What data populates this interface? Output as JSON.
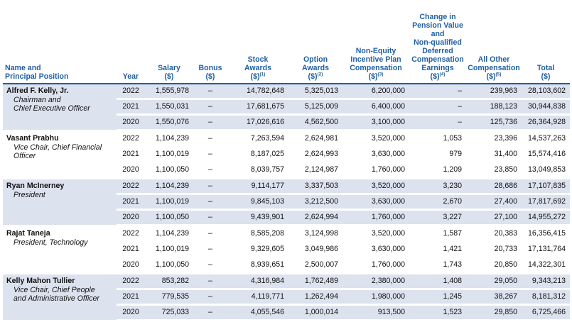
{
  "headers": {
    "name": "Name and\nPrincipal Position",
    "year": "Year",
    "salary": "Salary\n($)",
    "bonus": "Bonus\n($)",
    "stock": "Stock\nAwards\n($)",
    "stock_note": "(1)",
    "option": "Option\nAwards\n($)",
    "option_note": "(2)",
    "nonequity": "Non-Equity\nIncentive Plan\nCompensation\n($)",
    "nonequity_note": "(3)",
    "pension": "Change in\nPension Value\nand\nNon-qualified\nDeferred\nCompensation\nEarnings\n($)",
    "pension_note": "(4)",
    "other": "All Other\nCompensation\n($)",
    "other_note": "(5)",
    "total": "Total\n($)"
  },
  "executives": [
    {
      "name": "Alfred F. Kelly, Jr.",
      "title": "Chairman and\nChief Executive Officer",
      "rows": [
        {
          "year": "2022",
          "salary": "1,555,978",
          "bonus": "–",
          "stock": "14,782,648",
          "option": "5,325,013",
          "nonequity": "6,200,000",
          "pension": "–",
          "other": "239,963",
          "total": "28,103,602"
        },
        {
          "year": "2021",
          "salary": "1,550,031",
          "bonus": "–",
          "stock": "17,681,675",
          "option": "5,125,009",
          "nonequity": "6,400,000",
          "pension": "–",
          "other": "188,123",
          "total": "30,944,838"
        },
        {
          "year": "2020",
          "salary": "1,550,076",
          "bonus": "–",
          "stock": "17,026,616",
          "option": "4,562,500",
          "nonequity": "3,100,000",
          "pension": "–",
          "other": "125,736",
          "total": "26,364,928"
        }
      ]
    },
    {
      "name": "Vasant Prabhu",
      "title": "Vice Chair, Chief Financial\nOfficer",
      "rows": [
        {
          "year": "2022",
          "salary": "1,104,239",
          "bonus": "–",
          "stock": "7,263,594",
          "option": "2,624,981",
          "nonequity": "3,520,000",
          "pension": "1,053",
          "other": "23,396",
          "total": "14,537,263"
        },
        {
          "year": "2021",
          "salary": "1,100,019",
          "bonus": "–",
          "stock": "8,187,025",
          "option": "2,624,993",
          "nonequity": "3,630,000",
          "pension": "979",
          "other": "31,400",
          "total": "15,574,416"
        },
        {
          "year": "2020",
          "salary": "1,100,050",
          "bonus": "–",
          "stock": "8,039,757",
          "option": "2,124,987",
          "nonequity": "1,760,000",
          "pension": "1,209",
          "other": "23,850",
          "total": "13,049,853"
        }
      ]
    },
    {
      "name": "Ryan McInerney",
      "title": "President",
      "rows": [
        {
          "year": "2022",
          "salary": "1,104,239",
          "bonus": "–",
          "stock": "9,114,177",
          "option": "3,337,503",
          "nonequity": "3,520,000",
          "pension": "3,230",
          "other": "28,686",
          "total": "17,107,835"
        },
        {
          "year": "2021",
          "salary": "1,100,019",
          "bonus": "–",
          "stock": "9,845,103",
          "option": "3,212,500",
          "nonequity": "3,630,000",
          "pension": "2,670",
          "other": "27,400",
          "total": "17,817,692"
        },
        {
          "year": "2020",
          "salary": "1,100,050",
          "bonus": "–",
          "stock": "9,439,901",
          "option": "2,624,994",
          "nonequity": "1,760,000",
          "pension": "3,227",
          "other": "27,100",
          "total": "14,955,272"
        }
      ]
    },
    {
      "name": "Rajat Taneja",
      "title": "President, Technology",
      "rows": [
        {
          "year": "2022",
          "salary": "1,104,239",
          "bonus": "–",
          "stock": "8,585,208",
          "option": "3,124,998",
          "nonequity": "3,520,000",
          "pension": "1,587",
          "other": "20,383",
          "total": "16,356,415"
        },
        {
          "year": "2021",
          "salary": "1,100,019",
          "bonus": "–",
          "stock": "9,329,605",
          "option": "3,049,986",
          "nonequity": "3,630,000",
          "pension": "1,421",
          "other": "20,733",
          "total": "17,131,764"
        },
        {
          "year": "2020",
          "salary": "1,100,050",
          "bonus": "–",
          "stock": "8,939,651",
          "option": "2,500,007",
          "nonequity": "1,760,000",
          "pension": "1,743",
          "other": "20,850",
          "total": "14,322,301"
        }
      ]
    },
    {
      "name": "Kelly Mahon Tullier",
      "title": "Vice Chair, Chief People\nand Administrative Officer",
      "rows": [
        {
          "year": "2022",
          "salary": "853,282",
          "bonus": "–",
          "stock": "4,316,984",
          "option": "1,762,489",
          "nonequity": "2,380,000",
          "pension": "1,408",
          "other": "29,050",
          "total": "9,343,213"
        },
        {
          "year": "2021",
          "salary": "779,535",
          "bonus": "–",
          "stock": "4,119,771",
          "option": "1,262,494",
          "nonequity": "1,980,000",
          "pension": "1,245",
          "other": "38,267",
          "total": "8,181,312"
        },
        {
          "year": "2020",
          "salary": "725,033",
          "bonus": "–",
          "stock": "4,055,546",
          "option": "1,000,014",
          "nonequity": "913,500",
          "pension": "1,523",
          "other": "29,850",
          "total": "6,725,466"
        }
      ]
    }
  ],
  "colors": {
    "header_text": "#1f5fa6",
    "shade": "#dde2ef"
  }
}
